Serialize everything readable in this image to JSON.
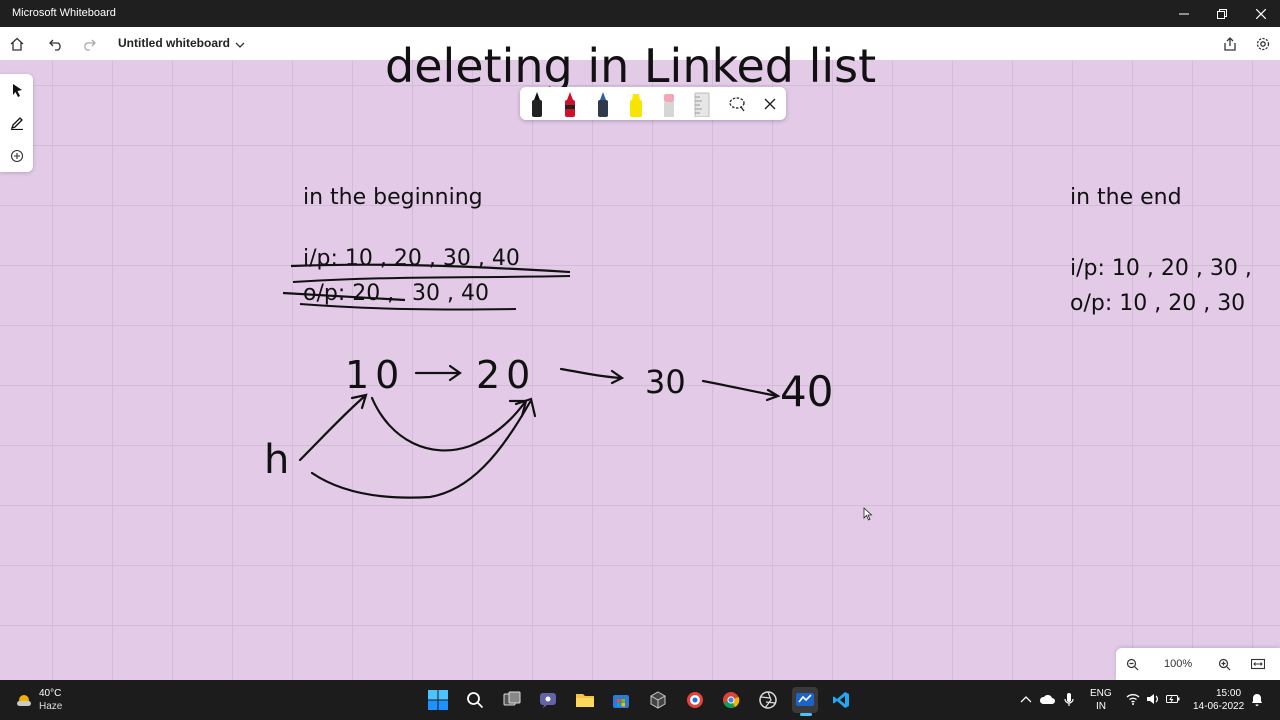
{
  "window": {
    "title": "Microsoft Whiteboard"
  },
  "toolbar": {
    "document_title": "Untitled whiteboard"
  },
  "board": {
    "heading": "deleting in Linked list",
    "section_beginning": {
      "title": "in the beginning",
      "input": "i/p: 10 , 20 , 30 , 40",
      "output_struck": "o/p: 20 ,",
      "output": "30 , 40"
    },
    "section_end": {
      "title": "in the end",
      "input": "i/p: 10 , 20 , 30 ,",
      "output": "o/p: 10 , 20 , 30"
    },
    "diagram": {
      "nodes": [
        "10",
        "20",
        "30",
        "40"
      ],
      "head_label": "h"
    }
  },
  "zoom": {
    "level": "100%"
  },
  "taskbar": {
    "weather_temp": "40°C",
    "weather_condition": "Haze",
    "lang_top": "ENG",
    "lang_bottom": "IN",
    "time": "15:00",
    "date": "14-06-2022"
  },
  "colors": {
    "canvas": "#e3cbe8",
    "grid": "#d3bcd8",
    "ink": "#111111",
    "accent": "#0078d4"
  }
}
